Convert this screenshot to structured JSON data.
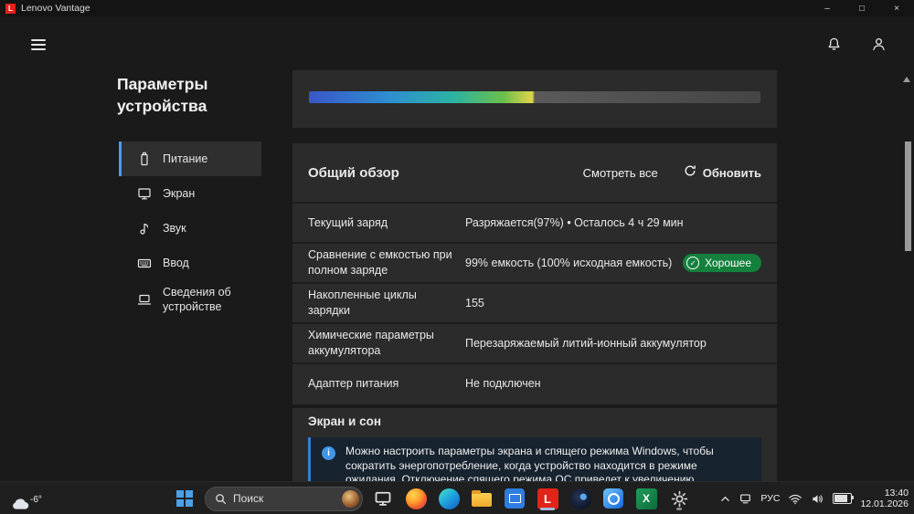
{
  "titlebar": {
    "app_name": "Lenovo Vantage",
    "logo_letter": "L",
    "minimize_glyph": "–",
    "maximize_glyph": "□",
    "close_glyph": "×"
  },
  "sidebar": {
    "title": "Параметры устройства",
    "items": [
      {
        "label": "Питание",
        "selected": true
      },
      {
        "label": "Экран",
        "selected": false
      },
      {
        "label": "Звук",
        "selected": false
      },
      {
        "label": "Ввод",
        "selected": false
      },
      {
        "label": "Сведения об устройстве",
        "selected": false
      }
    ]
  },
  "overview": {
    "title": "Общий обзор",
    "see_all_label": "Смотреть все",
    "refresh_label": "Обновить",
    "rows": [
      {
        "label": "Текущий заряд",
        "value": "Разряжается(97%)  •  Осталось 4 ч 29 мин"
      },
      {
        "label": "Сравнение с емкостью при полном заряде",
        "value": "99% емкость (100% исходная емкость)",
        "badge": "Хорошее"
      },
      {
        "label": "Накопленные циклы зарядки",
        "value": "155"
      },
      {
        "label": "Химические параметры аккумулятора",
        "value": "Перезаряжаемый литий-ионный аккумулятор"
      },
      {
        "label": "Адаптер питания",
        "value": "Не подключен"
      }
    ]
  },
  "screen_sleep": {
    "title": "Экран и сон",
    "info_text": "Можно настроить параметры экрана и спящего режима Windows, чтобы сократить энергопотребление, когда устройство находится в режиме ожидания. Отключение спящего режима ОС приведет к увеличению энергопотребления. Рекомендуется"
  },
  "capacity_bar": {
    "fill_percent": 50,
    "gradient": [
      "#3a57c9",
      "#2e8fd0",
      "#2bb3a3",
      "#6abf4b",
      "#e0d44a"
    ],
    "remainder_color": "#4a4a4a"
  },
  "taskbar": {
    "weather_temp": "-6°",
    "search_label": "Поиск",
    "language": "РУС",
    "time": "13:40",
    "date": "12.01.2026"
  },
  "icons": {
    "vantage_letter": "L",
    "excel_letter": "X"
  },
  "colors": {
    "accent_blue": "#4a9eea",
    "badge_green": "#15803d",
    "info_blue": "#3f96e4",
    "vantage_red": "#e2231a",
    "card_bg": "#2b2b2b",
    "page_bg": "#1a1a1a"
  }
}
